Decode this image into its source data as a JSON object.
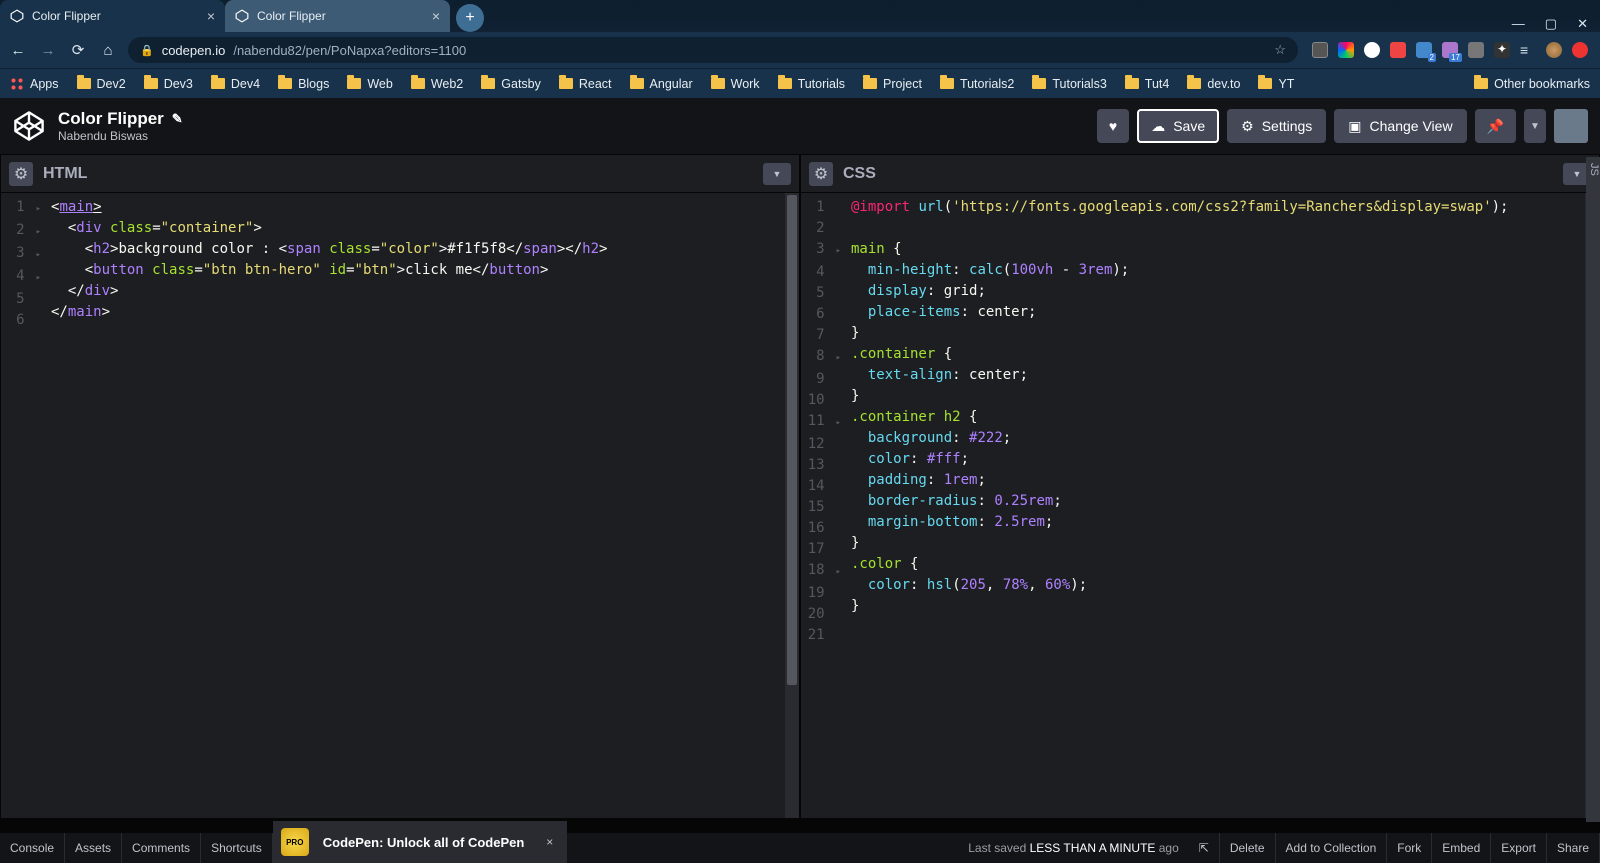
{
  "browser": {
    "tabs": [
      {
        "title": "Color Flipper",
        "active": true
      },
      {
        "title": "Color Flipper",
        "active": false
      }
    ],
    "url_domain": "codepen.io",
    "url_path": "/nabendu82/pen/PoNapxa?editors=1100"
  },
  "bookmarks": {
    "apps": "Apps",
    "items": [
      "Dev2",
      "Dev3",
      "Dev4",
      "Blogs",
      "Web",
      "Web2",
      "Gatsby",
      "React",
      "Angular",
      "Work",
      "Tutorials",
      "Project",
      "Tutorials2",
      "Tutorials3",
      "Tut4",
      "dev.to",
      "YT"
    ],
    "other": "Other bookmarks"
  },
  "codepen": {
    "title": "Color Flipper",
    "author": "Nabendu Biswas",
    "buttons": {
      "save": "Save",
      "settings": "Settings",
      "change_view": "Change View"
    }
  },
  "panels": {
    "html": {
      "title": "HTML",
      "lines": [
        {
          "n": 1,
          "fold": true,
          "html": "<span class=\"p\">&lt;</span><span class=\"t underline\">main</span><span class=\"p underline\">&gt;</span>"
        },
        {
          "n": 2,
          "fold": true,
          "html": "  <span class=\"p\">&lt;</span><span class=\"t\">div</span> <span class=\"a\">class</span><span class=\"p\">=</span><span class=\"s\">\"container\"</span><span class=\"p\">&gt;</span>"
        },
        {
          "n": 3,
          "fold": true,
          "html": "    <span class=\"p\">&lt;</span><span class=\"t\">h2</span><span class=\"p\">&gt;</span><span class=\"txt\">background color : </span><span class=\"p\">&lt;</span><span class=\"t\">span</span> <span class=\"a\">class</span><span class=\"p\">=</span><span class=\"s\">\"color\"</span><span class=\"p\">&gt;</span><span class=\"txt\">#f1f5f8</span><span class=\"p\">&lt;/</span><span class=\"t\">span</span><span class=\"p\">&gt;&lt;/</span><span class=\"t\">h2</span><span class=\"p\">&gt;</span>"
        },
        {
          "n": 4,
          "fold": true,
          "html": "    <span class=\"p\">&lt;</span><span class=\"t\">button</span> <span class=\"a\">class</span><span class=\"p\">=</span><span class=\"s\">\"btn btn-hero\"</span> <span class=\"a\">id</span><span class=\"p\">=</span><span class=\"s\">\"btn\"</span><span class=\"p\">&gt;</span><span class=\"txt\">click me</span><span class=\"p\">&lt;/</span><span class=\"t\">button</span><span class=\"p\">&gt;</span>"
        },
        {
          "n": 5,
          "fold": false,
          "html": "  <span class=\"p\">&lt;/</span><span class=\"t\">div</span><span class=\"p\">&gt;</span>"
        },
        {
          "n": 6,
          "fold": false,
          "html": "<span class=\"p\">&lt;/</span><span class=\"t\">main</span><span class=\"p\">&gt;</span>"
        }
      ]
    },
    "css": {
      "title": "CSS",
      "lines": [
        {
          "n": 1,
          "fold": false,
          "html": "<span class=\"at\">@import</span> <span class=\"fn\">url</span><span class=\"p\">(</span><span class=\"s\">'https://fonts.googleapis.com/css2?family=Ranchers&amp;display=swap'</span><span class=\"p\">);</span>"
        },
        {
          "n": 2,
          "fold": false,
          "html": " "
        },
        {
          "n": 3,
          "fold": true,
          "html": "<span class=\"sel\">main</span> <span class=\"p\">{</span>"
        },
        {
          "n": 4,
          "fold": false,
          "html": "  <span class=\"prop\">min-height</span><span class=\"p\">:</span> <span class=\"fn\">calc</span><span class=\"p\">(</span><span class=\"num\">100vh</span> <span class=\"p\">-</span> <span class=\"num\">3rem</span><span class=\"p\">);</span>"
        },
        {
          "n": 5,
          "fold": false,
          "html": "  <span class=\"prop\">display</span><span class=\"p\">:</span> <span class=\"txt\">grid</span><span class=\"p\">;</span>"
        },
        {
          "n": 6,
          "fold": false,
          "html": "  <span class=\"prop\">place-items</span><span class=\"p\">:</span> <span class=\"txt\">center</span><span class=\"p\">;</span>"
        },
        {
          "n": 7,
          "fold": false,
          "html": "<span class=\"p\">}</span>"
        },
        {
          "n": 8,
          "fold": true,
          "html": "<span class=\"sel\">.container</span> <span class=\"p\">{</span>"
        },
        {
          "n": 9,
          "fold": false,
          "html": "  <span class=\"prop\">text-align</span><span class=\"p\">:</span> <span class=\"txt\">center</span><span class=\"p\">;</span>"
        },
        {
          "n": 10,
          "fold": false,
          "html": "<span class=\"p\">}</span>"
        },
        {
          "n": 11,
          "fold": true,
          "html": "<span class=\"sel\">.container h2</span> <span class=\"p\">{</span>"
        },
        {
          "n": 12,
          "fold": false,
          "html": "  <span class=\"prop\">background</span><span class=\"p\">:</span> <span class=\"num\">#222</span><span class=\"p\">;</span>"
        },
        {
          "n": 13,
          "fold": false,
          "html": "  <span class=\"prop\">color</span><span class=\"p\">:</span> <span class=\"num\">#fff</span><span class=\"p\">;</span>"
        },
        {
          "n": 14,
          "fold": false,
          "html": "  <span class=\"prop\">padding</span><span class=\"p\">:</span> <span class=\"num\">1rem</span><span class=\"p\">;</span>"
        },
        {
          "n": 15,
          "fold": false,
          "html": "  <span class=\"prop\">border-radius</span><span class=\"p\">:</span> <span class=\"num\">0.25rem</span><span class=\"p\">;</span>"
        },
        {
          "n": 16,
          "fold": false,
          "html": "  <span class=\"prop\">margin-bottom</span><span class=\"p\">:</span> <span class=\"num\">2.5rem</span><span class=\"p\">;</span>"
        },
        {
          "n": 17,
          "fold": false,
          "html": "<span class=\"p\">}</span>"
        },
        {
          "n": 18,
          "fold": true,
          "html": "<span class=\"sel\">.color</span> <span class=\"p\">{</span>"
        },
        {
          "n": 19,
          "fold": false,
          "html": "  <span class=\"prop\">color</span><span class=\"p\">:</span> <span class=\"fn\">hsl</span><span class=\"p\">(</span><span class=\"num\">205</span><span class=\"p\">,</span> <span class=\"num\">78%</span><span class=\"p\">,</span> <span class=\"num\">60%</span><span class=\"p\">);</span>"
        },
        {
          "n": 20,
          "fold": false,
          "html": "<span class=\"p\">}</span>"
        },
        {
          "n": 21,
          "fold": false,
          "html": " "
        }
      ]
    },
    "js_label": "JS"
  },
  "footer": {
    "tabs": [
      "Console",
      "Assets",
      "Comments",
      "Shortcuts"
    ],
    "pro_text": "CodePen: Unlock all of CodePen",
    "pro_badge": "PRO",
    "saved_prefix": "Last saved ",
    "saved_relative": "LESS THAN A MINUTE",
    "saved_suffix": " ago",
    "right": [
      "Delete",
      "Add to Collection",
      "Fork",
      "Embed",
      "Export",
      "Share"
    ]
  }
}
